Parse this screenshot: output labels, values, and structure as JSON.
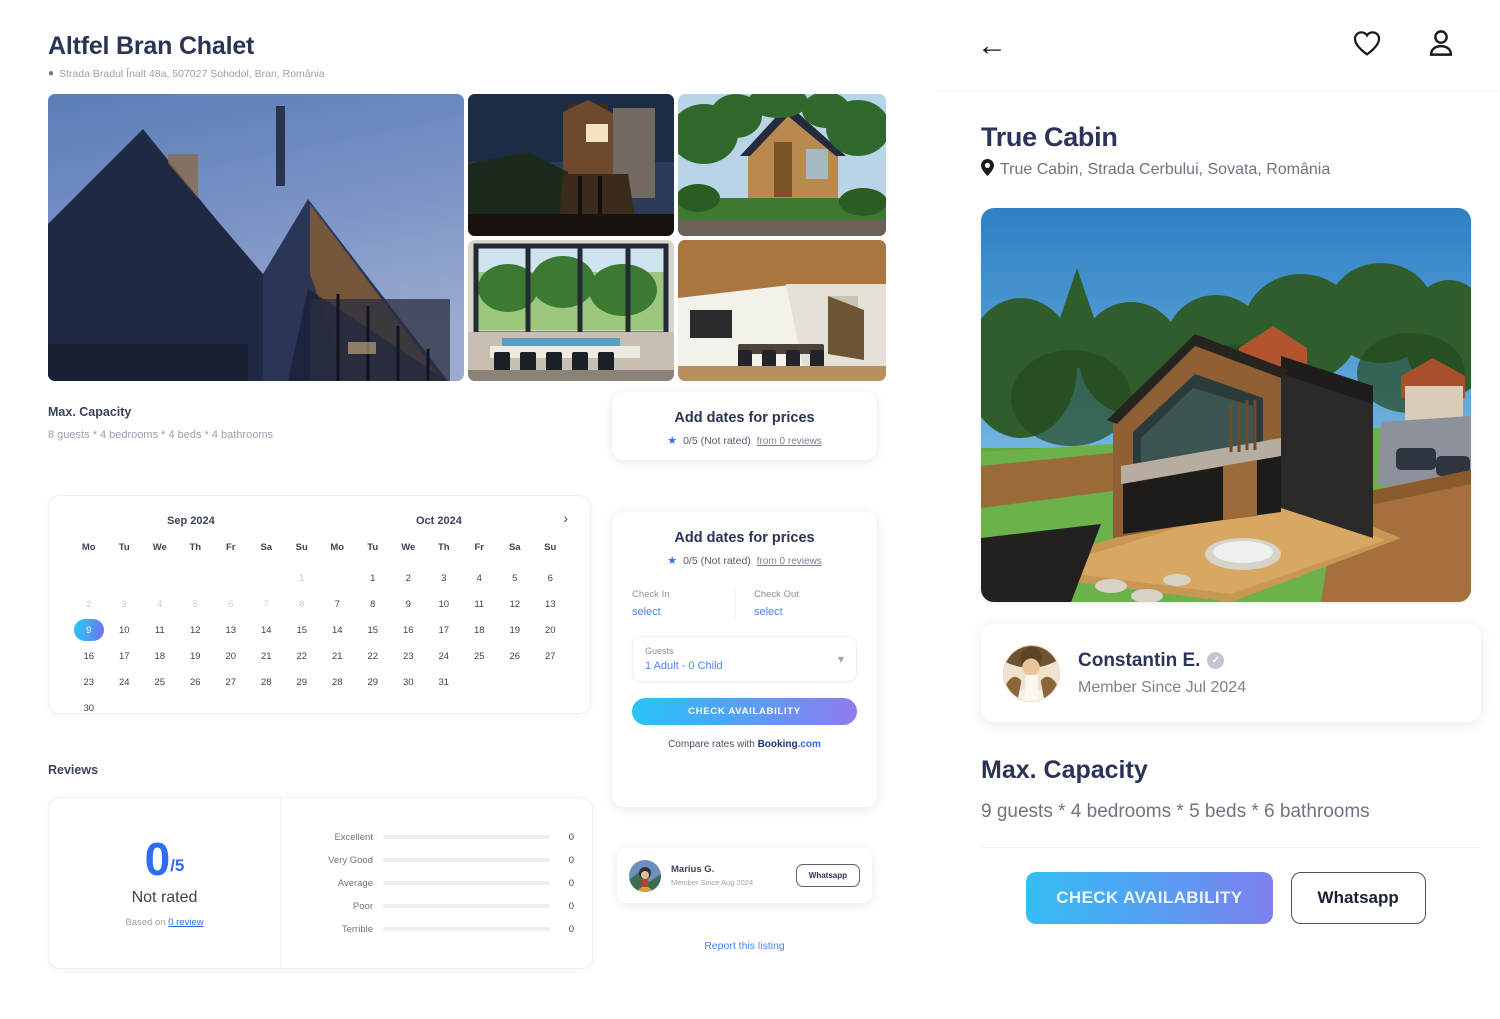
{
  "desktop": {
    "title": "Altfel Bran Chalet",
    "address": "Strada Bradul Înalt 48a, 507027 Șohodol, Bran, România",
    "pin_icon": "location-pin-icon",
    "capacity": {
      "title": "Max. Capacity",
      "text": "8 guests * 4 bedrooms * 4 beds * 4 bathrooms"
    },
    "price_card_top": {
      "heading": "Add dates for prices",
      "rating": "0/5 (Not rated)",
      "reviews_link": "from 0 reviews",
      "star_icon": "star-icon"
    },
    "calendar": {
      "month_left": "Sep 2024",
      "month_right": "Oct 2024",
      "next_icon": "chevron-right-icon",
      "dow": [
        "Mo",
        "Tu",
        "We",
        "Th",
        "Fr",
        "Sa",
        "Su",
        "Mo",
        "Tu",
        "We",
        "Th",
        "Fr",
        "Sa",
        "Su"
      ],
      "selected_day": "9",
      "weeks": [
        [
          "",
          "",
          "",
          "",
          "",
          "",
          "1",
          "",
          "1",
          "2",
          "3",
          "4",
          "5",
          "6"
        ],
        [
          "2",
          "3",
          "4",
          "5",
          "6",
          "7",
          "8",
          "7",
          "8",
          "9",
          "10",
          "11",
          "12",
          "13"
        ],
        [
          "9",
          "10",
          "11",
          "12",
          "13",
          "14",
          "15",
          "14",
          "15",
          "16",
          "17",
          "18",
          "19",
          "20"
        ],
        [
          "16",
          "17",
          "18",
          "19",
          "20",
          "21",
          "22",
          "21",
          "22",
          "23",
          "24",
          "25",
          "26",
          "27"
        ],
        [
          "23",
          "24",
          "25",
          "26",
          "27",
          "28",
          "29",
          "28",
          "29",
          "30",
          "31",
          "",
          "",
          ""
        ],
        [
          "30",
          "",
          "",
          "",
          "",
          "",
          "",
          "",
          "",
          "",
          "",
          "",
          "",
          ""
        ]
      ],
      "dim_cells": [
        [
          0,
          1
        ],
        [
          0,
          2
        ],
        [
          0,
          3
        ],
        [
          0,
          4
        ],
        [
          0,
          5
        ],
        [
          0,
          6
        ],
        [
          1,
          0
        ],
        [
          1,
          1
        ],
        [
          1,
          2
        ],
        [
          1,
          3
        ],
        [
          1,
          4
        ],
        [
          1,
          5
        ],
        [
          1,
          6
        ]
      ]
    },
    "reviews": {
      "section_label": "Reviews",
      "score": "0",
      "denominator": "/5",
      "not_rated": "Not rated",
      "based_on_prefix": "Based on",
      "based_on_link": "0 review",
      "bars": [
        {
          "label": "Excellent",
          "value": "0",
          "pct": 0
        },
        {
          "label": "Very Good",
          "value": "0",
          "pct": 0
        },
        {
          "label": "Average",
          "value": "0",
          "pct": 0
        },
        {
          "label": "Poor",
          "value": "0",
          "pct": 0
        },
        {
          "label": "Terrible",
          "value": "0",
          "pct": 0
        }
      ]
    },
    "booking": {
      "heading": "Add dates for prices",
      "rating": "0/5 (Not rated)",
      "reviews_link": "from 0 reviews",
      "checkin_label": "Check In",
      "checkin_value": "select",
      "checkout_label": "Check Out",
      "checkout_value": "select",
      "guests_label": "Guests",
      "guests_value": "1 Adult - 0 Child",
      "chevron_icon": "chevron-down-icon",
      "check_button": "CHECK AVAILABILITY",
      "compare_prefix": "Compare rates with",
      "compare_brand": "Booking",
      "compare_tld": ".com"
    },
    "host": {
      "name": "Marius G.",
      "since": "Member Since Aug 2024",
      "whatsapp_button": "Whatsapp"
    },
    "report_link": "Report this listing",
    "gallery": {
      "main_alt": "chalet-exterior-dusk",
      "thumbs": [
        "chalet-side-stone",
        "cabin-garden-daylight",
        "dining-glass-wall",
        "interior-wood-ceiling"
      ]
    }
  },
  "mobile": {
    "back_icon": "arrow-left-icon",
    "favorite_icon": "heart-icon",
    "account_icon": "user-icon",
    "title": "True Cabin",
    "address": "True Cabin, Strada Cerbului, Sovata, România",
    "pin_icon": "location-pin-icon",
    "photo_alt": "true-cabin-exterior",
    "host": {
      "name": "Constantin E.",
      "verified_icon": "verified-check-icon",
      "since": "Member Since Jul 2024"
    },
    "capacity": {
      "title": "Max. Capacity",
      "text": "9 guests * 4 bedrooms * 5 beds * 6 bathrooms"
    },
    "actions": {
      "check_button": "CHECK AVAILABILITY",
      "whatsapp_button": "Whatsapp"
    }
  },
  "colors": {
    "accent_blue": "#2f6bf5",
    "link_blue": "#4b86f7",
    "title_navy": "#2b3356",
    "muted": "#9aa0ae",
    "gradient_start": "#29c3f5",
    "gradient_end": "#8f7bf0"
  }
}
